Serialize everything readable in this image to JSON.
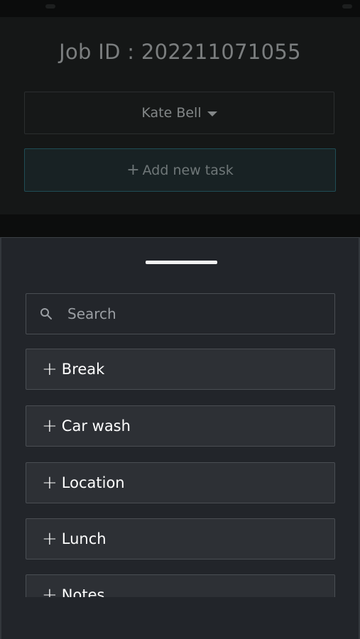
{
  "header": {
    "job_id_label": "Job ID : 202211071055"
  },
  "assignee": {
    "selected": "Kate Bell"
  },
  "add_task": {
    "label": "Add new task",
    "icon": "plus-icon"
  },
  "sheet": {
    "search": {
      "placeholder": "Search",
      "value": "",
      "icon": "search-icon"
    },
    "tasks": [
      {
        "label": "Break"
      },
      {
        "label": "Car wash"
      },
      {
        "label": "Location"
      },
      {
        "label": "Lunch"
      },
      {
        "label": "Notes"
      }
    ]
  },
  "colors": {
    "sheet_background": "#22252a",
    "item_background": "#2d3035",
    "accent_border": "#1f4d55"
  }
}
